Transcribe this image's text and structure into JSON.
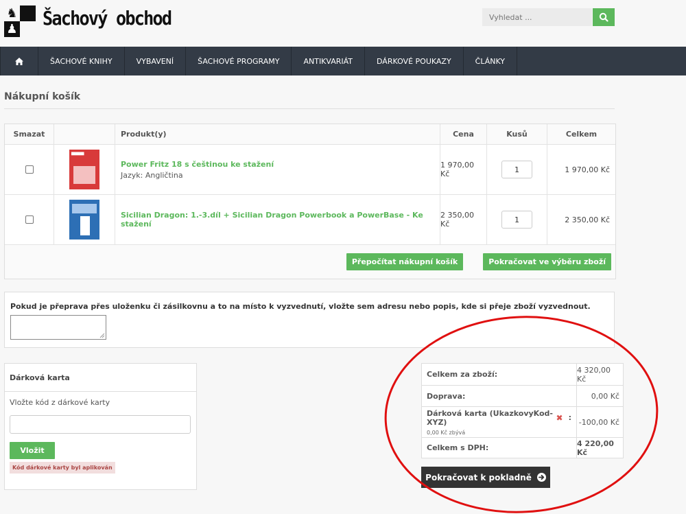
{
  "header": {
    "brand": "Šachový obchod",
    "search_placeholder": "Vyhledat ..."
  },
  "nav": {
    "items": [
      "ŠACHOVÉ KNIHY",
      "VYBAVENÍ",
      "ŠACHOVÉ PROGRAMY",
      "ANTIKVARIÁT",
      "DÁRKOVÉ POUKAZY",
      "ČLÁNKY"
    ]
  },
  "page": {
    "title": "Nákupní košík"
  },
  "cart": {
    "headers": {
      "delete": "Smazat",
      "product": "Produkt(y)",
      "price": "Cena",
      "qty": "Kusů",
      "total": "Celkem"
    },
    "items": [
      {
        "name": "Power Fritz 18 s češtinou ke stažení",
        "attribute": "Jazyk: Angličtina",
        "price": "1 970,00 Kč",
        "qty": "1",
        "total": "1 970,00 Kč",
        "thumb_color": "#d83a3a"
      },
      {
        "name": "Sicilian Dragon: 1.-3.díl + Sicilian Dragon Powerbook a PowerBase - Ke stažení",
        "attribute": "",
        "price": "2 350,00 Kč",
        "qty": "1",
        "total": "2 350,00 Kč",
        "thumb_color": "#2d6fb5"
      }
    ],
    "recalc_label": "Přepočítat nákupní košík",
    "continue_label": "Pokračovat ve výběru zboží"
  },
  "note": {
    "text": "Pokud je přeprava přes uloženku či zásilkovnu a to na místo k vyzvednutí, vložte sem adresu nebo popis, kde si přeje zboží vyzvednout."
  },
  "gift": {
    "title": "Dárková karta",
    "label": "Vložte kód z dárkové karty",
    "apply_label": "Vložit",
    "message": "Kód dárkové karty byl aplikován"
  },
  "totals": {
    "subtotal_label": "Celkem za zboží:",
    "subtotal_value": "4 320,00 Kč",
    "shipping_label": "Doprava:",
    "shipping_value": "0,00 Kč",
    "giftcard_label": "Dárková karta (UkazkovyKod-XYZ)",
    "giftcard_colon": ":",
    "giftcard_remaining": "0,00 Kč zbývá",
    "giftcard_value": "-100,00 Kč",
    "total_label": "Celkem s DPH:",
    "total_value": "4 220,00 Kč"
  },
  "checkout_label": "Pokračovat k pokladně",
  "colors": {
    "accent_green": "#5cb85c",
    "nav_bg": "#333b46",
    "annotation_red": "#e01010"
  }
}
